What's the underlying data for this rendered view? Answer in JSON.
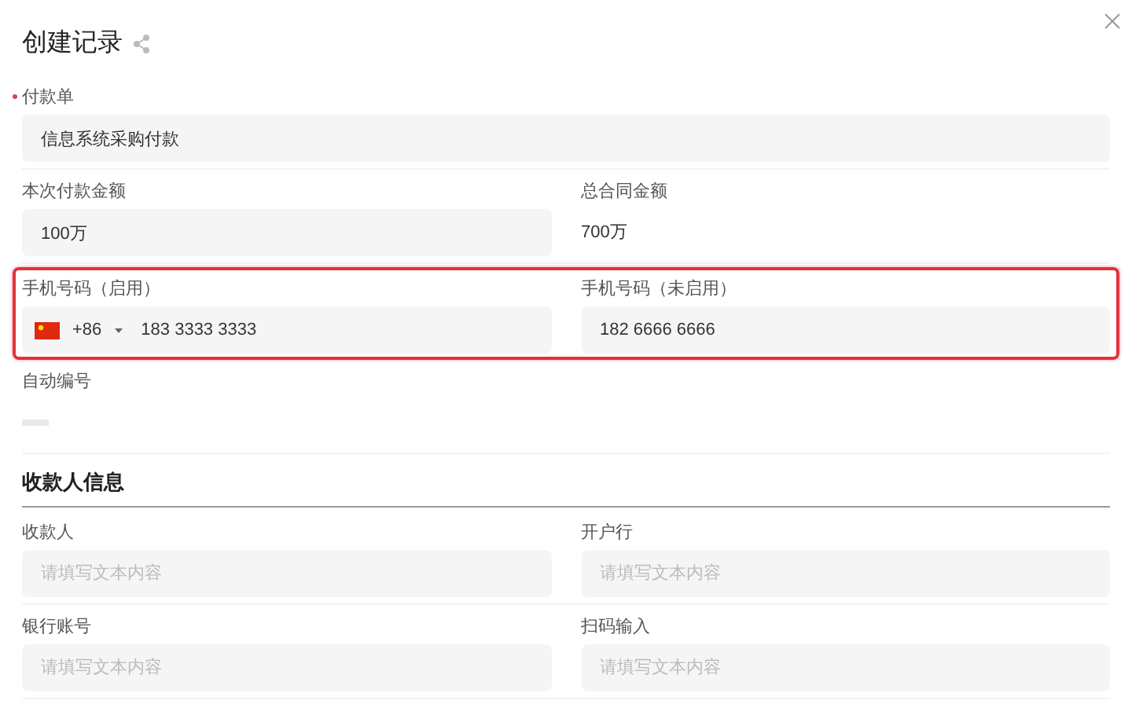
{
  "title": "创建记录",
  "rows": [
    {
      "highlighted": false,
      "fields": [
        {
          "label": "付款单",
          "required": true,
          "kind": "input",
          "value": "信息系统采购付款"
        }
      ]
    },
    {
      "highlighted": false,
      "fields": [
        {
          "label": "本次付款金额",
          "required": false,
          "kind": "input",
          "value": "100万"
        },
        {
          "label": "总合同金额",
          "required": false,
          "kind": "text",
          "value": "700万"
        }
      ]
    },
    {
      "highlighted": true,
      "fields": [
        {
          "label": "手机号码（启用）",
          "required": false,
          "kind": "phone",
          "code": "+86",
          "value": "183 3333 3333"
        },
        {
          "label": "手机号码（未启用）",
          "required": false,
          "kind": "input",
          "value": "182 6666 6666"
        }
      ]
    },
    {
      "highlighted": false,
      "fields": [
        {
          "label": "自动编号",
          "required": false,
          "kind": "auto"
        }
      ]
    }
  ],
  "section": {
    "title": "收款人信息",
    "rows": [
      {
        "highlighted": false,
        "fields": [
          {
            "label": "收款人",
            "required": false,
            "kind": "input",
            "placeholder": "请填写文本内容"
          },
          {
            "label": "开户行",
            "required": false,
            "kind": "input",
            "placeholder": "请填写文本内容"
          }
        ]
      },
      {
        "highlighted": false,
        "fields": [
          {
            "label": "银行账号",
            "required": false,
            "kind": "input",
            "placeholder": "请填写文本内容"
          },
          {
            "label": "扫码输入",
            "required": false,
            "kind": "input",
            "placeholder": "请填写文本内容"
          }
        ]
      }
    ]
  }
}
